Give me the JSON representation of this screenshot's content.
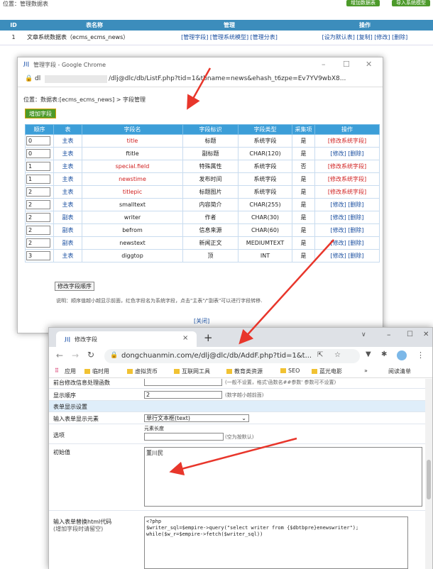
{
  "top": {
    "position": "位置：管理数据表",
    "btn_add": "增加数据表",
    "btn_import": "导入系统模型"
  },
  "main_table": {
    "headers": [
      "ID",
      "表名称",
      "管理",
      "操作"
    ],
    "row": {
      "id": "1",
      "name": "文章系统数据表（ecms_ecms_news）",
      "manage": [
        "[管理字段]",
        "[管理系统模型]",
        "[管理分表]"
      ],
      "ops": [
        "[设为默认表]",
        "[复制]",
        "[修改]",
        "[删除]"
      ]
    }
  },
  "win1": {
    "title": "管理字段 - Google Chrome",
    "url_prefix": "dl",
    "url": "/dlj@dlc/db/ListF.php?tid=1&tbname=news&ehash_t6zpe=Ev7YV9wbX8...",
    "breadcrumb": "位置：数据表:[ecms_ecms_news] > 字段管理",
    "add_btn": "增加字段",
    "headers": [
      "顺序",
      "表",
      "字段名",
      "字段标识",
      "字段类型",
      "采集项",
      "操作"
    ],
    "rows": [
      {
        "ord": "0",
        "tb": "主表",
        "name": "title",
        "label": "标题",
        "type": "系统字段",
        "col": "是",
        "op": "[修改系统字段]",
        "sys": true
      },
      {
        "ord": "0",
        "tb": "主表",
        "name": "ftitle",
        "label": "副标题",
        "type": "CHAR(120)",
        "col": "是",
        "op": "[修改] [删除]",
        "sys": false
      },
      {
        "ord": "1",
        "tb": "主表",
        "name": "special.field",
        "label": "特殊属性",
        "type": "系统字段",
        "col": "否",
        "op": "[修改系统字段]",
        "sys": true
      },
      {
        "ord": "1",
        "tb": "主表",
        "name": "newstime",
        "label": "发布时间",
        "type": "系统字段",
        "col": "是",
        "op": "[修改系统字段]",
        "sys": true
      },
      {
        "ord": "2",
        "tb": "主表",
        "name": "titlepic",
        "label": "标题图片",
        "type": "系统字段",
        "col": "是",
        "op": "[修改系统字段]",
        "sys": true
      },
      {
        "ord": "2",
        "tb": "主表",
        "name": "smalltext",
        "label": "内容简介",
        "type": "CHAR(255)",
        "col": "是",
        "op": "[修改] [删除]",
        "sys": false
      },
      {
        "ord": "2",
        "tb": "副表",
        "name": "writer",
        "label": "作者",
        "type": "CHAR(30)",
        "col": "是",
        "op": "[修改] [删除]",
        "sys": false
      },
      {
        "ord": "2",
        "tb": "副表",
        "name": "befrom",
        "label": "信息来源",
        "type": "CHAR(60)",
        "col": "是",
        "op": "[修改] [删除]",
        "sys": false
      },
      {
        "ord": "2",
        "tb": "副表",
        "name": "newstext",
        "label": "新闻正文",
        "type": "MEDIUMTEXT",
        "col": "是",
        "op": "[修改] [删除]",
        "sys": false
      },
      {
        "ord": "3",
        "tb": "主表",
        "name": "diggtop",
        "label": "顶",
        "type": "INT",
        "col": "是",
        "op": "[修改] [删除]",
        "sys": false
      }
    ],
    "order_btn": "修改字段顺序",
    "note": "说明：顺序值越小越显示前面，红色字段名为系统字段，点击\"主表\"/\"副表\"可以进行字段转移.",
    "close": "[关闭]"
  },
  "win2": {
    "tab_title": "修改字段",
    "url": "dongchuanmin.com/e/dlj@dlc/db/AddF.php?tid=1&t...",
    "bookmarks": [
      "应用",
      "临时用",
      "虚拟货币",
      "互联网工具",
      "教育类资源",
      "SEO",
      "蓝光电影"
    ],
    "reading_list": "阅读清单",
    "row_prev_label": "前台修改信息处理函数",
    "row_prev_hint": "(一般不设置，格式'函数名##参数' 参数可不设置)",
    "display_label": "显示顺序",
    "display_value": "2",
    "display_hint": "(数字越小越前面)",
    "section": "表单显示设置",
    "input_label": "输入表单显示元素",
    "input_value": "单行文本框(text)",
    "option_label": "选项",
    "option_sub": "元素长度",
    "option_hint": "(空为按默认)",
    "init_label": "初始值",
    "init_value": "董川民",
    "replace_label": "输入表单替换html代码",
    "replace_sub": "(增加字段时请留空)",
    "code": [
      "<?php",
      "$writer_sql=$empire->query(\"select writer from {$dbtbpre}enewswriter\");",
      "while($w_r=$empire->fetch($writer_sql))"
    ]
  }
}
